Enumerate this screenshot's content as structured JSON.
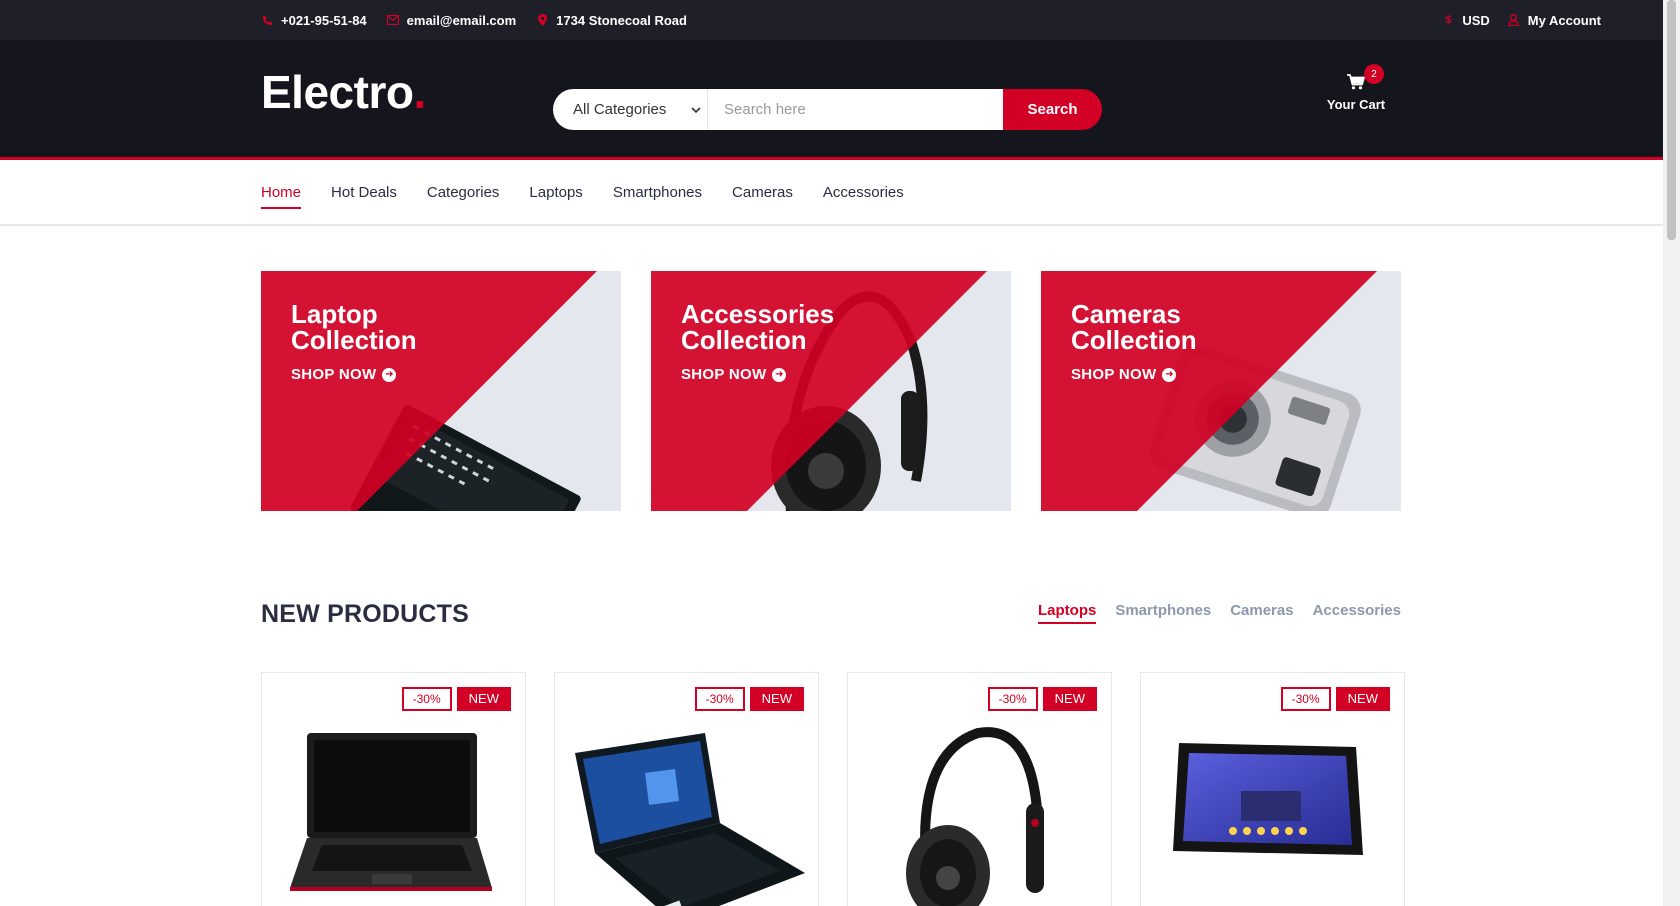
{
  "topbar": {
    "phone": "+021-95-51-84",
    "email": "email@email.com",
    "address": "1734 Stonecoal Road",
    "currency": "USD",
    "account": "My Account"
  },
  "header": {
    "logo": "Electro",
    "logo_dot": ".",
    "category_select": "All Categories",
    "search_placeholder": "Search here",
    "search_button": "Search",
    "cart_label": "Your Cart",
    "cart_qty": "2"
  },
  "nav": {
    "items": [
      "Home",
      "Hot Deals",
      "Categories",
      "Laptops",
      "Smartphones",
      "Cameras",
      "Accessories"
    ],
    "active": "Home"
  },
  "collections": [
    {
      "line1": "Laptop",
      "line2": "Collection",
      "cta": "SHOP NOW"
    },
    {
      "line1": "Accessories",
      "line2": "Collection",
      "cta": "SHOP NOW"
    },
    {
      "line1": "Cameras",
      "line2": "Collection",
      "cta": "SHOP NOW"
    }
  ],
  "new_products": {
    "title": "NEW PRODUCTS",
    "tabs": [
      "Laptops",
      "Smartphones",
      "Cameras",
      "Accessories"
    ],
    "active_tab": "Laptops",
    "cards": [
      {
        "sale": "-30%",
        "new": "NEW",
        "image": "laptop-black"
      },
      {
        "sale": "-30%",
        "new": "NEW",
        "image": "laptop-windows"
      },
      {
        "sale": "-30%",
        "new": "NEW",
        "image": "headphones"
      },
      {
        "sale": "-30%",
        "new": "NEW",
        "image": "tablet"
      }
    ]
  },
  "colors": {
    "accent": "#d10024",
    "topbar": "#1e1f29",
    "header": "#15161d",
    "collection_bg": "#e4e7ed"
  }
}
